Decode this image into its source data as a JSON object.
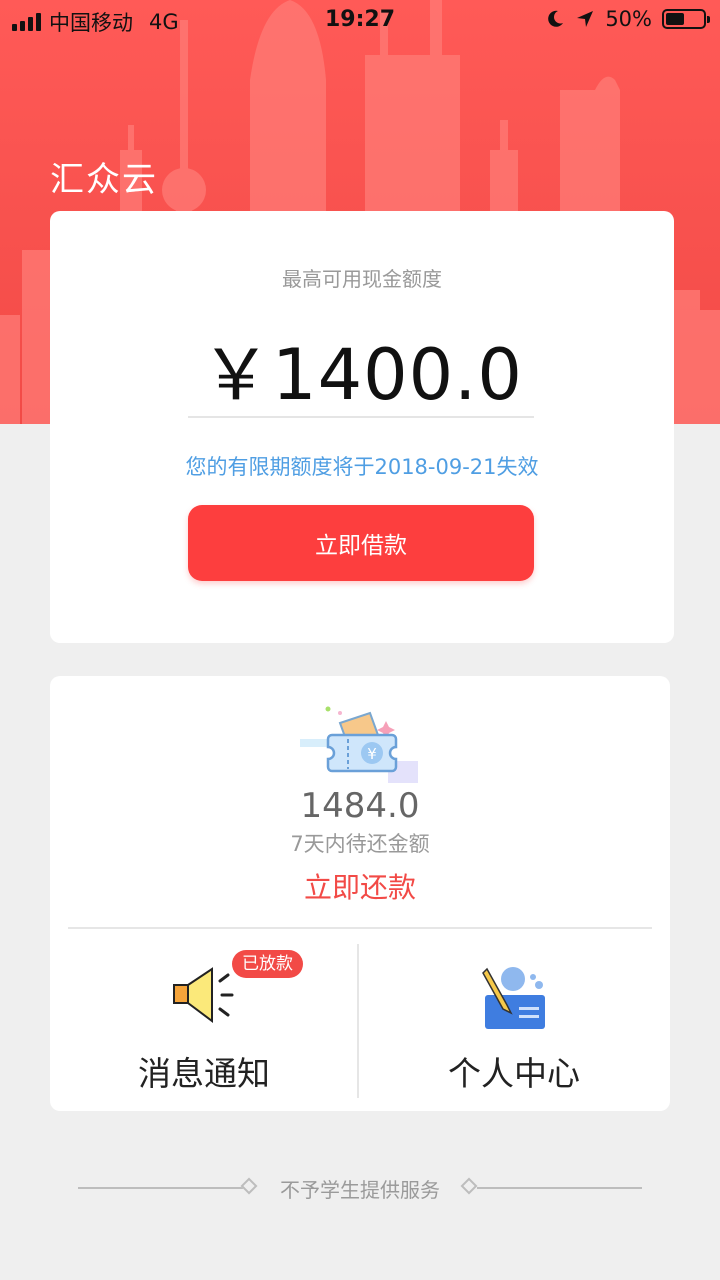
{
  "status_bar": {
    "carrier": "中国移动",
    "network": "4G",
    "time": "19:27",
    "battery": "50%",
    "battery_level": 0.5
  },
  "app": {
    "title": "汇众云"
  },
  "credit": {
    "label": "最高可用现金额度",
    "amount": "￥1400.0",
    "expire_note": "您的有限期额度将于2018-09-21失效",
    "borrow_button": "立即借款"
  },
  "repay": {
    "amount": "1484.0",
    "label": "7天内待还金额",
    "action": "立即还款"
  },
  "tiles": {
    "messages": {
      "label": "消息通知",
      "badge": "已放款"
    },
    "profile": {
      "label": "个人中心"
    }
  },
  "footer": {
    "text": "不予学生提供服务"
  },
  "colors": {
    "brand_red": "#f24a46",
    "button_red": "#fd3e3e",
    "link_blue": "#4f9ee3"
  },
  "icons": [
    "signal-icon",
    "moon-icon",
    "location-arrow-icon",
    "battery-icon",
    "wallet-coupon-icon",
    "speaker-icon",
    "user-profile-icon",
    "diamond-icon"
  ]
}
